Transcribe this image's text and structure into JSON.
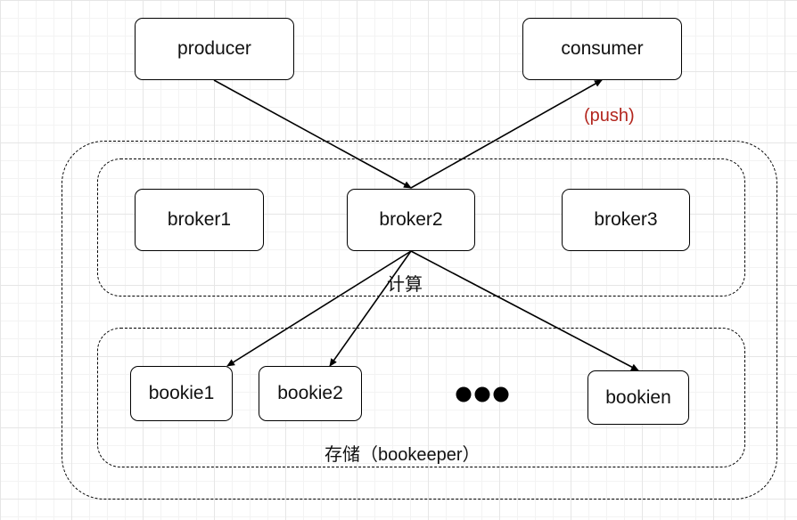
{
  "nodes": {
    "producer": "producer",
    "consumer": "consumer",
    "broker1": "broker1",
    "broker2": "broker2",
    "broker3": "broker3",
    "bookie1": "bookie1",
    "bookie2": "bookie2",
    "bookien": "bookien"
  },
  "labels": {
    "push": "(push)",
    "compute": "计算",
    "storage": "存储（bookeeper）"
  },
  "colors": {
    "push_label": "#b3261e",
    "line": "#000000"
  },
  "icons": {
    "ellipsis": "ellipsis-dots-icon"
  }
}
